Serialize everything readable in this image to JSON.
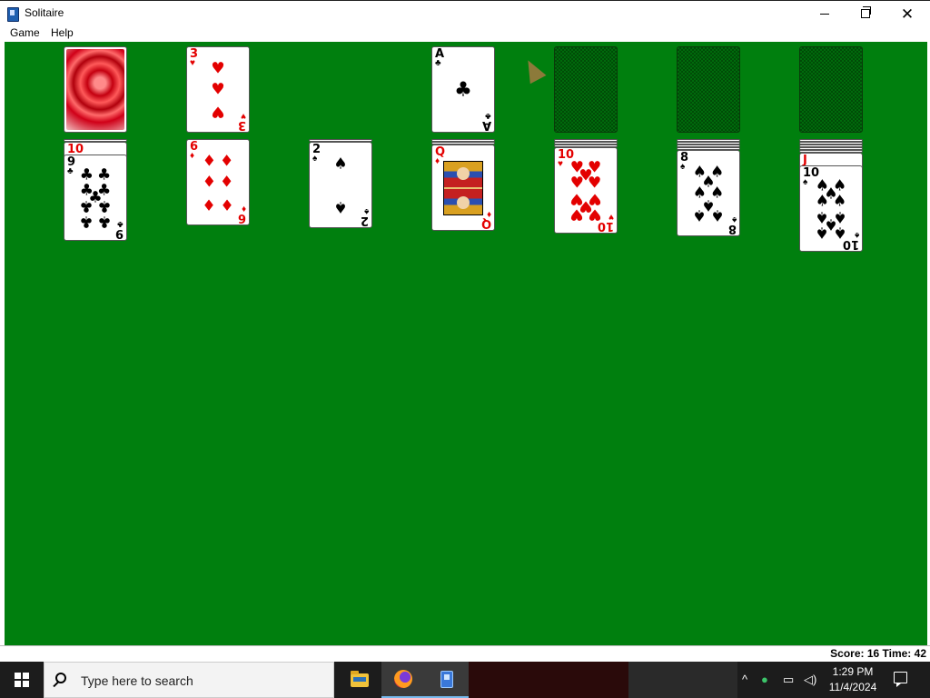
{
  "window": {
    "title": "Solitaire",
    "menu": [
      "Game",
      "Help"
    ],
    "controls": {
      "minimize": "—",
      "close": "✕"
    }
  },
  "status": {
    "text": "Score: 16 Time: 42",
    "score": 16,
    "time": 42
  },
  "game": {
    "stock": {
      "face_down": true,
      "back_design": "red-swirl"
    },
    "waste": [
      {
        "rank": "3",
        "suit": "♥",
        "color": "red"
      }
    ],
    "foundations": [
      {
        "top": {
          "rank": "A",
          "suit": "♣",
          "color": "black"
        }
      },
      {
        "top": null
      },
      {
        "top": null
      },
      {
        "top": null
      }
    ],
    "tableau": [
      {
        "hidden": 1,
        "cards": [
          {
            "rank": "10",
            "suit": "♥",
            "color": "red"
          },
          {
            "rank": "9",
            "suit": "♣",
            "color": "black"
          }
        ]
      },
      {
        "hidden": 0,
        "cards": [
          {
            "rank": "6",
            "suit": "♦",
            "color": "red"
          }
        ]
      },
      {
        "hidden": 1,
        "cards": [
          {
            "rank": "2",
            "suit": "♠",
            "color": "black"
          }
        ]
      },
      {
        "hidden": 2,
        "cards": [
          {
            "rank": "Q",
            "suit": "♦",
            "color": "red"
          }
        ]
      },
      {
        "hidden": 3,
        "cards": [
          {
            "rank": "10",
            "suit": "♥",
            "color": "red"
          }
        ]
      },
      {
        "hidden": 4,
        "cards": [
          {
            "rank": "8",
            "suit": "♠",
            "color": "black"
          }
        ]
      },
      {
        "hidden": 5,
        "cards": [
          {
            "rank": "J",
            "suit": "♥",
            "color": "red"
          },
          {
            "rank": "10",
            "suit": "♠",
            "color": "black"
          }
        ]
      }
    ]
  },
  "colors": {
    "felt": "#007f0e",
    "red_suit": "#e30000",
    "black_suit": "#000000"
  },
  "taskbar": {
    "search_placeholder": "Type here to search",
    "apps": [
      "file-explorer-icon",
      "firefox-icon",
      "solitaire-icon"
    ],
    "tray_icons": [
      "chevron-up-icon",
      "people-icon",
      "network-icon",
      "volume-icon"
    ],
    "time": "1:29 PM",
    "date": "11/4/2024"
  }
}
